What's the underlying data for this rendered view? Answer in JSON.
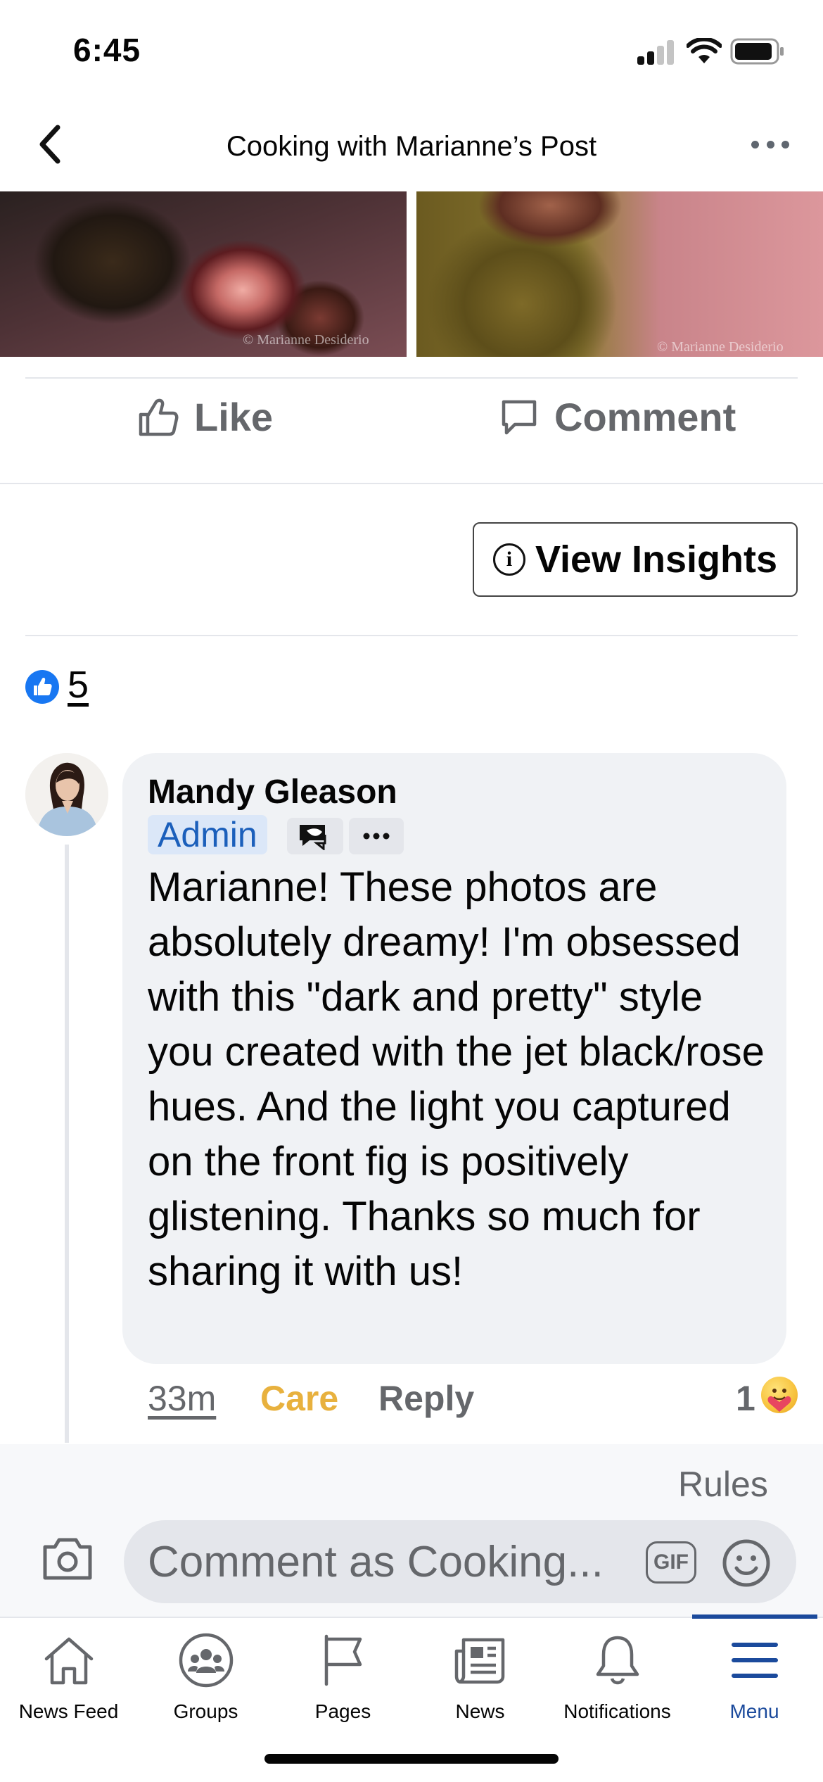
{
  "status_bar": {
    "time": "6:45"
  },
  "header": {
    "title": "Cooking with Marianne’s Post"
  },
  "photos": {
    "watermark_1": "© Marianne Desiderio",
    "watermark_2": "© Marianne Desiderio"
  },
  "actions": {
    "like_label": "Like",
    "comment_label": "Comment"
  },
  "insights": {
    "label": "View Insights"
  },
  "reactions": {
    "count": "5"
  },
  "comment": {
    "author": "Mandy Gleason",
    "badge": "Admin",
    "text": "Marianne! These photos are absolutely dreamy! I'm obsessed with this \"dark and pretty\" style you created with the jet black/rose hues. And the light you captured on the front fig is positively glistening. Thanks so much for sharing it with us!",
    "time": "33m",
    "reaction_action": "Care",
    "reply_label": "Reply",
    "reaction_count": "1"
  },
  "composer": {
    "rules_label": "Rules",
    "placeholder": "Comment as Cooking...",
    "gif_label": "GIF"
  },
  "tabs": [
    {
      "label": "News Feed",
      "icon": "home-icon"
    },
    {
      "label": "Groups",
      "icon": "groups-icon"
    },
    {
      "label": "Pages",
      "icon": "flag-icon"
    },
    {
      "label": "News",
      "icon": "news-icon"
    },
    {
      "label": "Notifications",
      "icon": "bell-icon"
    },
    {
      "label": "Menu",
      "icon": "menu-icon",
      "active": true
    }
  ],
  "colors": {
    "accent": "#1b4a9c",
    "care": "#e8b13e",
    "like_blue": "#1877f2",
    "admin_badge_bg": "#dbe7f8"
  }
}
